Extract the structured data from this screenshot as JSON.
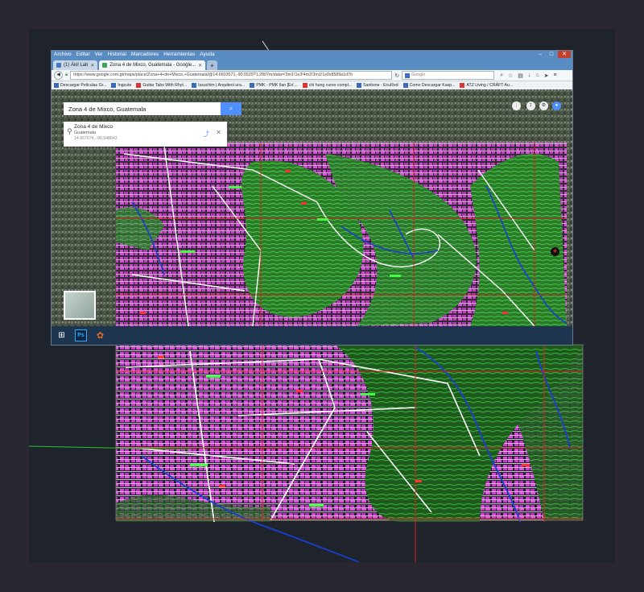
{
  "browser": {
    "menu": [
      "Archivo",
      "Editar",
      "Ver",
      "Historial",
      "Marcadores",
      "Herramientas",
      "Ayuda"
    ],
    "tabs": [
      {
        "title": "(1) Ákil Lab",
        "active": false
      },
      {
        "title": "Zona 4 de Mixco, Guatemala - Google...",
        "active": true
      }
    ],
    "url": "https://www.google.com.gt/maps/place/Zona+4+de+Mixco,+Guatemala/@14.6603571,-90.5529?1,2807m/data=!3m1!1e3!4m2!3m1!1s0x8589a1d7b",
    "search_placeholder": "Google",
    "bookmarks": [
      "Descargar Peliculas Gr...",
      "Ingcute",
      "Guitar Tabs With Rhyt...",
      "Issuchim | Arquitect ura...",
      "PMK - PMK Ilan [En'...",
      "chi hung cures compl...",
      "Sanitone - EcuRed",
      "Como Descargar Kasp...",
      "ATZ Living / CRAFT Au..."
    ]
  },
  "map": {
    "search_query": "Zona 4 de Mixco, Guatemala",
    "result_title": "Zona 4 de Mixco",
    "result_subtitle": "Guatemala",
    "result_coords": "14.667074, -90.548643"
  },
  "colors": {
    "cad_bg": "#1f232b",
    "vegetation": "#2a8a2a",
    "parcels": "#e040e0",
    "roads": "#ffffff",
    "rivers": "#1a3fd0",
    "grid": "#d42020"
  }
}
